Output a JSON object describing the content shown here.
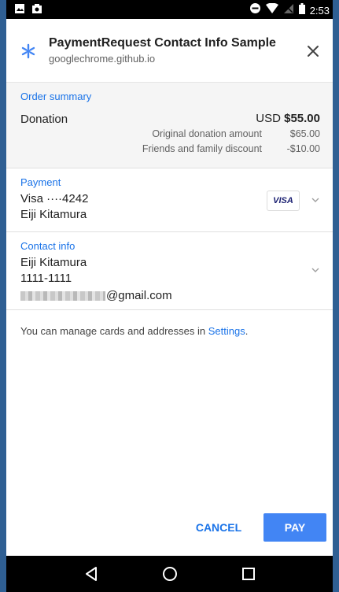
{
  "status_bar": {
    "time": "2:53"
  },
  "header": {
    "title": "PaymentRequest Contact Info Sample",
    "origin": "googlechrome.github.io",
    "close_symbol": "✕"
  },
  "order_summary": {
    "label": "Order summary",
    "item": "Donation",
    "currency": "USD",
    "total": "$55.00",
    "line_items": [
      {
        "label": "Original donation amount",
        "amount": "$65.00"
      },
      {
        "label": "Friends and family discount",
        "amount": "-$10.00"
      }
    ]
  },
  "payment": {
    "label": "Payment",
    "card": "Visa  ····4242",
    "cardholder": "Eiji Kitamura",
    "card_brand": "VISA"
  },
  "contact": {
    "label": "Contact info",
    "name": "Eiji Kitamura",
    "phone": "1111-1111",
    "email_domain": "@gmail.com"
  },
  "manage_text": {
    "prefix": "You can manage cards and addresses in ",
    "link": "Settings",
    "suffix": "."
  },
  "buttons": {
    "cancel": "CANCEL",
    "pay": "PAY"
  },
  "colors": {
    "accent": "#1a73e8",
    "pay_button": "#4285f4",
    "summary_bg": "#f5f5f5"
  },
  "icons": {
    "status_left": [
      "image-icon",
      "photo-notification-icon"
    ],
    "status_right": [
      "do-not-disturb-icon",
      "wifi-icon",
      "no-signal-icon",
      "battery-icon"
    ],
    "nav": [
      "back-icon",
      "home-icon",
      "recents-icon"
    ]
  }
}
